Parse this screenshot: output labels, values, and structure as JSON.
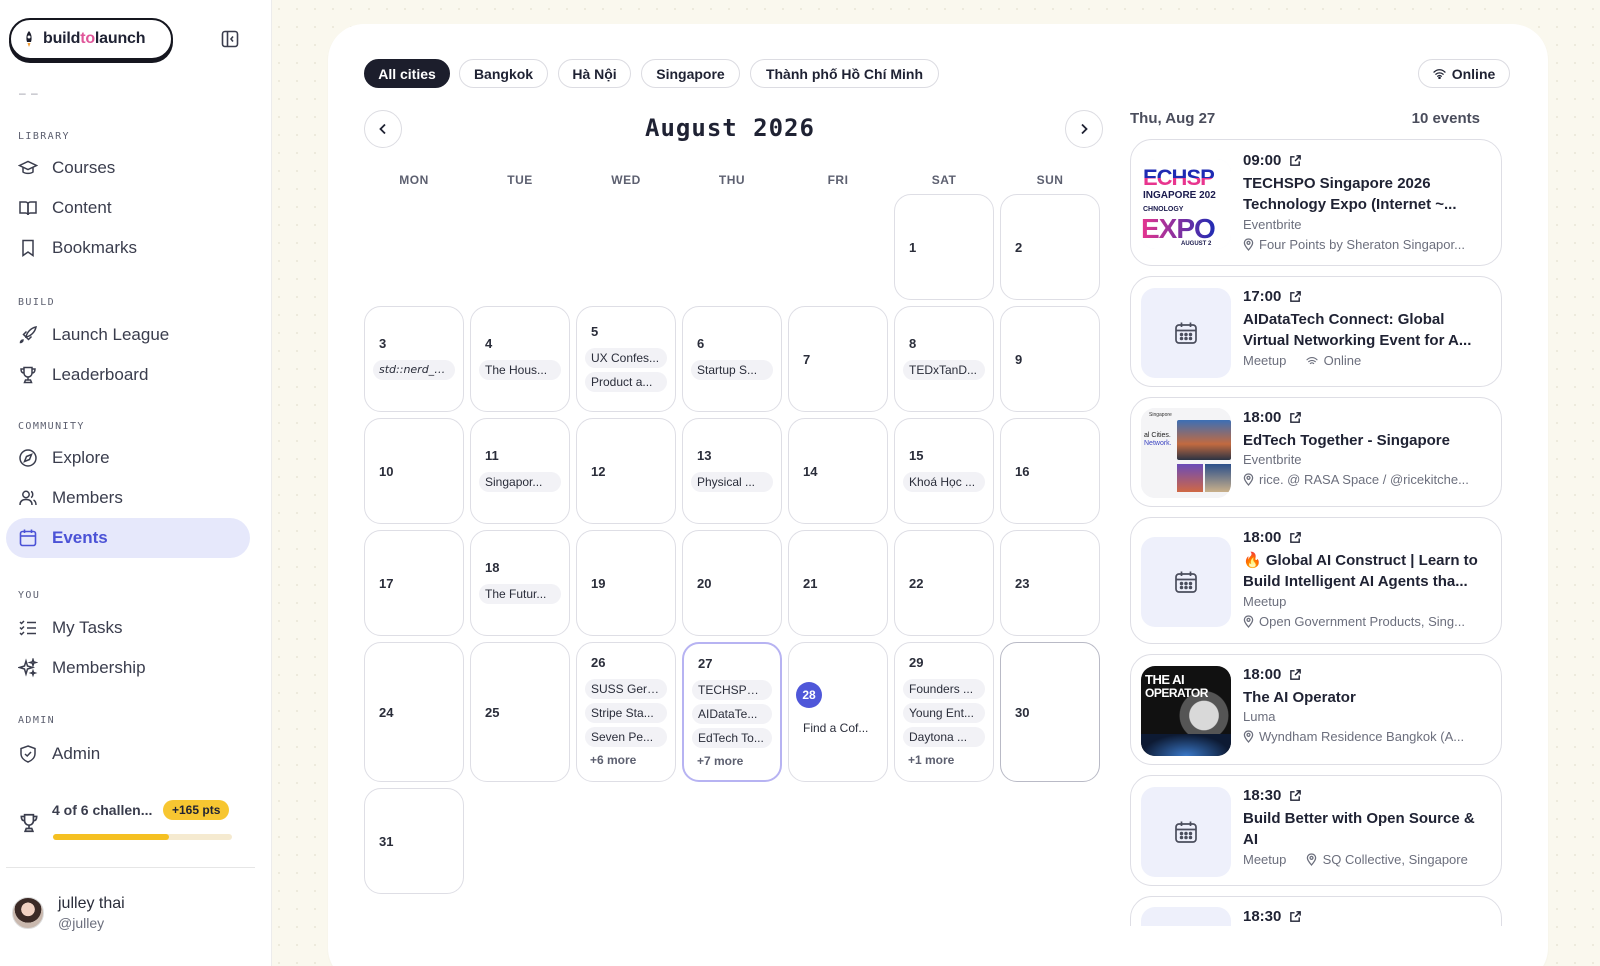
{
  "brand": {
    "pre": "build",
    "accent": "to",
    "post": "launch",
    "accent_color": "#e0569a"
  },
  "sidebar": {
    "dash": "– –",
    "sections": {
      "library": "LIBRARY",
      "build": "BUILD",
      "community": "COMMUNITY",
      "you": "YOU",
      "admin": "ADMIN"
    },
    "items": {
      "courses": "Courses",
      "content": "Content",
      "bookmarks": "Bookmarks",
      "launch_league": "Launch League",
      "leaderboard": "Leaderboard",
      "explore": "Explore",
      "members": "Members",
      "events": "Events",
      "my_tasks": "My Tasks",
      "membership": "Membership",
      "admin": "Admin"
    },
    "active_item": "events",
    "challenge": {
      "text": "4 of 6 challen...",
      "points": "+165 pts",
      "progress": 0.65
    },
    "user": {
      "name": "julley thai",
      "handle": "@julley"
    }
  },
  "filters": {
    "cities": [
      "All cities",
      "Bangkok",
      "Hà Nội",
      "Singapore",
      "Thành phố Hồ Chí Minh"
    ],
    "active_city": "All cities",
    "online": "Online"
  },
  "calendar": {
    "month_title": "August 2026",
    "weekdays": [
      "MON",
      "TUE",
      "WED",
      "THU",
      "FRI",
      "SAT",
      "SUN"
    ],
    "today": 28,
    "selected": 27,
    "weeks": [
      [
        null,
        null,
        null,
        null,
        null,
        {
          "day": 1,
          "events": []
        },
        {
          "day": 2,
          "events": []
        }
      ],
      [
        {
          "day": 3,
          "events": [
            "std::nerd_s..."
          ]
        },
        {
          "day": 4,
          "events": [
            "The Hous..."
          ]
        },
        {
          "day": 5,
          "events": [
            "UX Confes...",
            "Product a..."
          ]
        },
        {
          "day": 6,
          "events": [
            "Startup S..."
          ]
        },
        {
          "day": 7,
          "events": []
        },
        {
          "day": 8,
          "events": [
            "TEDxTanD..."
          ]
        },
        {
          "day": 9,
          "events": []
        }
      ],
      [
        {
          "day": 10,
          "events": []
        },
        {
          "day": 11,
          "events": [
            "Singapor..."
          ]
        },
        {
          "day": 12,
          "events": []
        },
        {
          "day": 13,
          "events": [
            "Physical ..."
          ]
        },
        {
          "day": 14,
          "events": []
        },
        {
          "day": 15,
          "events": [
            "Khoá Học ..."
          ]
        },
        {
          "day": 16,
          "events": []
        }
      ],
      [
        {
          "day": 17,
          "events": []
        },
        {
          "day": 18,
          "events": [
            "The Futur..."
          ]
        },
        {
          "day": 19,
          "events": []
        },
        {
          "day": 20,
          "events": []
        },
        {
          "day": 21,
          "events": []
        },
        {
          "day": 22,
          "events": []
        },
        {
          "day": 23,
          "events": []
        }
      ],
      [
        {
          "day": 24,
          "events": []
        },
        {
          "day": 25,
          "events": []
        },
        {
          "day": 26,
          "events": [
            "SUSS Gero...",
            "Stripe Sta...",
            "Seven Pe..."
          ],
          "more": "+6 more"
        },
        {
          "day": 27,
          "events": [
            "TECHSPO ...",
            "AIDataTe...",
            "EdTech To..."
          ],
          "more": "+7 more"
        },
        {
          "day": 28,
          "events": [
            "Find a Cof..."
          ]
        },
        {
          "day": 29,
          "events": [
            "Founders ...",
            "Young Ent...",
            "Daytona ..."
          ],
          "more": "+1 more"
        },
        {
          "day": 30,
          "events": []
        }
      ],
      [
        {
          "day": 31,
          "events": []
        },
        null,
        null,
        null,
        null,
        null,
        null
      ]
    ]
  },
  "day": {
    "label": "Thu, Aug 27",
    "count": "10 events",
    "events": [
      {
        "time": "09:00",
        "title": "TECHSPO Singapore 2026 Technology Expo (Internet ~...",
        "source": "Eventbrite",
        "location": "Four Points by Sheraton Singapor...",
        "thumb": "techspo",
        "thumb_texts": [
          "ECHSP",
          "INGAPORE 202",
          "CHNOLOGY",
          "EXPO",
          "AUGUST 2"
        ]
      },
      {
        "time": "17:00",
        "title": "AIDataTech Connect: Global Virtual Networking Event for A...",
        "source": "Meetup",
        "location": "Online",
        "thumb": "calendar",
        "online": true
      },
      {
        "time": "18:00",
        "title": "EdTech Together - Singapore",
        "source": "Eventbrite",
        "location": "rice. @ RASA Space / @ricekitche...",
        "thumb": "edtech",
        "thumb_texts": [
          "Singapore",
          "al Cities.",
          "Network."
        ]
      },
      {
        "time": "18:00",
        "title": "🔥 Global AI Construct | Learn to Build Intelligent AI Agents tha...",
        "source": "Meetup",
        "location": "Open Government Products, Sing...",
        "thumb": "calendar"
      },
      {
        "time": "18:00",
        "title": "The AI Operator",
        "source": "Luma",
        "location": "Wyndham Residence Bangkok (A...",
        "thumb": "operator",
        "thumb_texts": [
          "THE AI",
          "OPERATOR"
        ]
      },
      {
        "time": "18:30",
        "title": "Build Better with Open Source & AI",
        "source": "Meetup",
        "location": "SQ Collective, Singapore",
        "thumb": "calendar",
        "inline_loc": true
      },
      {
        "time": "18:30",
        "title": "",
        "source": "",
        "location": "",
        "thumb": "calendar"
      }
    ]
  }
}
